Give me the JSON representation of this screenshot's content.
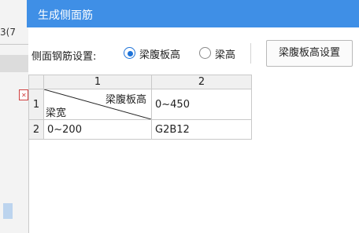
{
  "background_app": {
    "fragment_text": "3(7"
  },
  "dialog": {
    "title": "生成侧面筋",
    "toolbar": {
      "setting_label": "侧面钢筋设置:",
      "radio_options": [
        {
          "label": "梁腹板高",
          "checked": true
        },
        {
          "label": "梁高",
          "checked": false
        }
      ],
      "settings_button": "梁腹板高设置"
    },
    "table": {
      "column_headers": [
        "1",
        "2"
      ],
      "row_headers": [
        "1",
        "2"
      ],
      "header_cell": {
        "top_right": "梁腹板高",
        "bottom_left": "梁宽"
      },
      "rows": [
        {
          "col1_range": "0~450"
        },
        {
          "col0": "0~200",
          "col1": "G2B12"
        }
      ]
    }
  },
  "colors": {
    "title_bar": "#3f8fe6",
    "radio_accent": "#1e73d8",
    "grid_line": "#c9c9c9"
  }
}
